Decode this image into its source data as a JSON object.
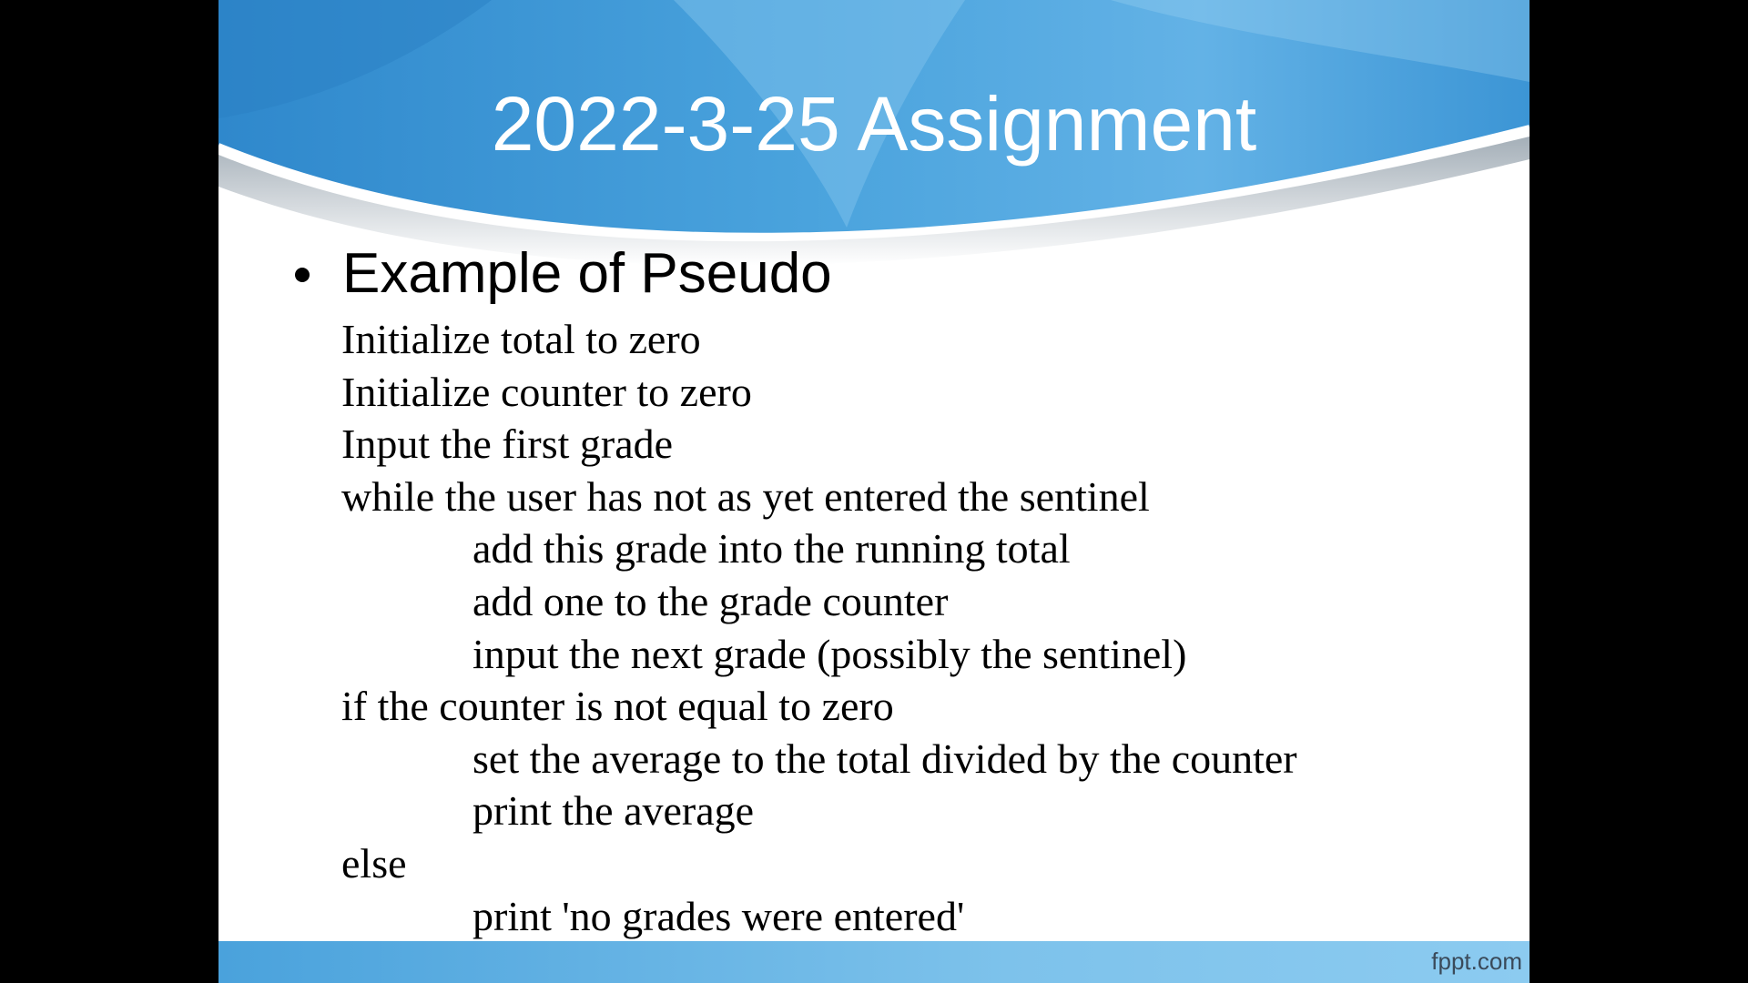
{
  "slide": {
    "title": "2022-3-25 Assignment",
    "bullet": "Example of Pseudo",
    "pseudocode": [
      {
        "text": "Initialize total to zero",
        "indent": 0
      },
      {
        "text": "Initialize counter to zero",
        "indent": 0
      },
      {
        "text": "Input the first grade",
        "indent": 0
      },
      {
        "text": "while the user has not as yet entered the sentinel",
        "indent": 0
      },
      {
        "text": "add this grade into the running total",
        "indent": 1
      },
      {
        "text": "add one to the grade counter",
        "indent": 1
      },
      {
        "text": "input the next grade (possibly the sentinel)",
        "indent": 1
      },
      {
        "text": "if the counter is not equal to zero",
        "indent": 0
      },
      {
        "text": "set the average to the total divided by the counter",
        "indent": 1
      },
      {
        "text": "print the average",
        "indent": 1
      },
      {
        "text": "else",
        "indent": 0
      },
      {
        "text": "print 'no grades were entered'",
        "indent": 1
      }
    ],
    "watermark": "fppt.com"
  },
  "colors": {
    "background": "#ffffff",
    "letterbox": "#000000",
    "header_blue": "#3f98d6",
    "header_light": "#7cc0ea",
    "title_text": "#ffffff",
    "body_text": "#000000"
  }
}
